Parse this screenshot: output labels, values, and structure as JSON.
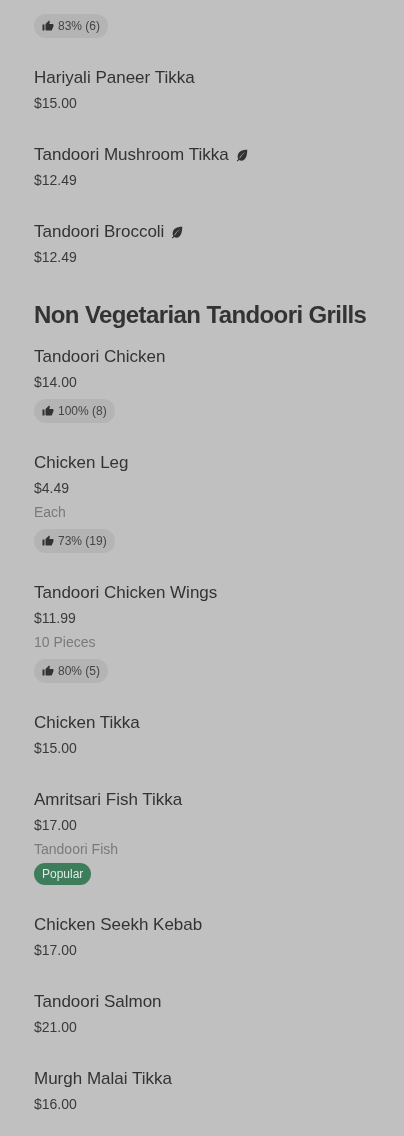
{
  "sections": [
    {
      "items": [
        {
          "rating": "83% (6)"
        },
        {
          "name": "Hariyali Paneer Tikka",
          "price": "$15.00",
          "vegetarian": false
        },
        {
          "name": "Tandoori Mushroom Tikka",
          "price": "$12.49",
          "vegetarian": true
        },
        {
          "name": "Tandoori Broccoli",
          "price": "$12.49",
          "vegetarian": true
        }
      ]
    },
    {
      "title": "Non Vegetarian Tandoori Grills",
      "items": [
        {
          "name": "Tandoori Chicken",
          "price": "$14.00",
          "vegetarian": false,
          "rating": "100% (8)"
        },
        {
          "name": "Chicken Leg",
          "price": "$4.49",
          "vegetarian": false,
          "note": "Each",
          "rating": "73% (19)"
        },
        {
          "name": "Tandoori Chicken Wings",
          "price": "$11.99",
          "vegetarian": false,
          "note": "10 Pieces",
          "rating": "80% (5)"
        },
        {
          "name": "Chicken Tikka",
          "price": "$15.00",
          "vegetarian": false
        },
        {
          "name": "Amritsari Fish Tikka",
          "price": "$17.00",
          "vegetarian": false,
          "note": "Tandoori Fish",
          "tag": "Popular"
        },
        {
          "name": "Chicken Seekh Kebab",
          "price": "$17.00",
          "vegetarian": false
        },
        {
          "name": "Tandoori Salmon",
          "price": "$21.00",
          "vegetarian": false
        },
        {
          "name": "Murgh Malai Tikka",
          "price": "$16.00",
          "vegetarian": false
        }
      ]
    }
  ]
}
